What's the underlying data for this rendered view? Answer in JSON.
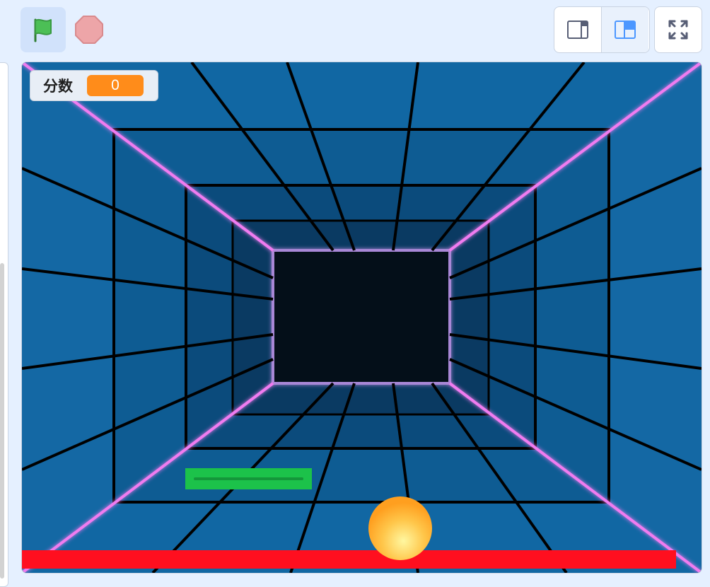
{
  "toolbar": {
    "green_flag_icon": "green-flag",
    "stop_icon": "stop-sign",
    "small_stage_icon": "small-stage-layout",
    "normal_stage_icon": "normal-stage-layout",
    "fullscreen_icon": "fullscreen",
    "accent_color": "#4c97ff"
  },
  "stage": {
    "variable_monitor": {
      "label": "分数",
      "value": "0",
      "value_color": "#ff8c1a"
    },
    "sprites": {
      "paddle_color": "#1cc24a",
      "ball_color": "#ffb12e",
      "floor_bar_color": "#ff0f1f"
    }
  }
}
